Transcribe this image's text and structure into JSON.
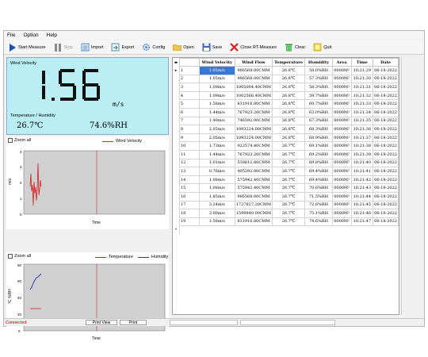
{
  "menu": [
    "File",
    "Option",
    "Help"
  ],
  "toolbar": [
    {
      "label": "Start Measure",
      "icon": "play-icon",
      "disabled": false
    },
    {
      "label": "Stop",
      "icon": "pause-icon",
      "disabled": true
    },
    {
      "label": "Import",
      "icon": "import-icon",
      "disabled": false
    },
    {
      "label": "Export",
      "icon": "export-icon",
      "disabled": false
    },
    {
      "label": "Config",
      "icon": "gear-icon",
      "disabled": false
    },
    {
      "label": "Open",
      "icon": "folder-icon",
      "disabled": false
    },
    {
      "label": "Save",
      "icon": "floppy-disk-icon",
      "disabled": false
    },
    {
      "label": "Close RT-Measure",
      "icon": "close-icon",
      "disabled": false
    },
    {
      "label": "Clear",
      "icon": "trash-icon",
      "disabled": false
    },
    {
      "label": "Quit",
      "icon": "quit-icon",
      "disabled": false
    }
  ],
  "readout": {
    "label": "Wind Velocity",
    "value": "1.56",
    "unit": "m/s",
    "th_label": "Temperature / Humidity",
    "temperature": "26.7℃",
    "humidity": "74.6%RH",
    "color": "#b9eef4"
  },
  "chart1": {
    "zoom_label": "Zoom all",
    "legend": "Wind Velocity",
    "ylabel": "m/s",
    "xlabel": "Time",
    "yticks": [
      "0",
      "1",
      "2",
      "3",
      "4"
    ]
  },
  "chart2": {
    "zoom_label": "Zoom all",
    "legend": [
      "Temperature",
      "Humidity"
    ],
    "ylabel": "℃ %RH",
    "xlabel": "Time",
    "yticks": [
      "0",
      "20",
      "40",
      "60",
      "80"
    ]
  },
  "colors": {
    "temperature": "#d42020",
    "humidity": "#2030b0",
    "wind": "#d42020"
  },
  "table": {
    "corner": "◂▸",
    "columns": [
      "",
      "Wind Velocity",
      "Wind Flow",
      "Temperature",
      "Humidity",
      "Area",
      "Time",
      "Date"
    ],
    "rows": [
      [
        "1",
        "1.05m/s",
        "986568.00CMM",
        "26.8℃",
        "58.0%RH",
        "0000M²",
        "10:21:29",
        "06-18-2022"
      ],
      [
        "2",
        "1.05m/s",
        "986568.00CMM",
        "26.8℃",
        "57.3%RH",
        "0000M²",
        "10:21:30",
        "06-18-2022"
      ],
      [
        "3",
        "1.09m/s",
        "1005004.40CMM",
        "26.8℃",
        "58.3%RH",
        "0000M²",
        "10:21:31",
        "06-18-2022"
      ],
      [
        "4",
        "1.09m/s",
        "1002566.40CMM",
        "26.8℃",
        "59.7%RH",
        "0000M²",
        "10:21:32",
        "06-18-2022"
      ],
      [
        "5",
        "1.56m/s",
        "831916.80CMM",
        "26.8℃",
        "60.7%RH",
        "0000M²",
        "10:21:33",
        "06-18-2022"
      ],
      [
        "6",
        "1.44m/s",
        "767923.20CMM",
        "26.8℃",
        "63.0%RH",
        "0000M²",
        "10:21:34",
        "06-18-2022"
      ],
      [
        "7",
        "1.40m/s",
        "746592.00CMM",
        "26.8℃",
        "67.3%RH",
        "0000M²",
        "10:21:35",
        "06-18-2022"
      ],
      [
        "8",
        "2.05m/s",
        "1093224.00CMM",
        "26.8℃",
        "68.3%RH",
        "0000M²",
        "10:21:36",
        "06-18-2022"
      ],
      [
        "9",
        "2.05m/s",
        "1093224.00CMM",
        "26.8℃",
        "68.9%RH",
        "0000M²",
        "10:21:37",
        "06-18-2022"
      ],
      [
        "10",
        "1.73m/s",
        "922574.40CMM",
        "26.7℃",
        "69.1%RH",
        "0000M²",
        "10:21:38",
        "06-18-2022"
      ],
      [
        "11",
        "1.44m/s",
        "767923.20CMM",
        "26.7℃",
        "69.2%RH",
        "0000M²",
        "10:21:39",
        "06-18-2022"
      ],
      [
        "12",
        "1.01m/s",
        "538612.80CMM",
        "26.7℃",
        "69.8%RH",
        "0000M²",
        "10:21:40",
        "06-18-2022"
      ],
      [
        "13",
        "0.76m/s",
        "405292.80CMM",
        "26.7℃",
        "69.4%RH",
        "0000M²",
        "10:21:41",
        "06-18-2022"
      ],
      [
        "14",
        "1.08m/s",
        "575942.40CMM",
        "26.7℃",
        "69.4%RH",
        "0000M²",
        "10:21:42",
        "06-18-2022"
      ],
      [
        "15",
        "1.08m/s",
        "575942.40CMM",
        "26.7℃",
        "70.6%RH",
        "0000M²",
        "10:21:43",
        "06-18-2022"
      ],
      [
        "16",
        "1.85m/s",
        "986568.00CMM",
        "26.7℃",
        "71.5%RH",
        "0000M²",
        "10:21:44",
        "06-18-2022"
      ],
      [
        "17",
        "3.24m/s",
        "1727827.20CMM",
        "26.7℃",
        "72.6%RH",
        "0000M²",
        "10:21:45",
        "06-18-2022"
      ],
      [
        "18",
        "3.00m/s",
        "1599840.00CMM",
        "26.7℃",
        "75.1%RH",
        "0000M²",
        "10:21:46",
        "06-18-2022"
      ],
      [
        "19",
        "1.56m/s",
        "831916.80CMM",
        "26.7℃",
        "74.6%RH",
        "0000M²",
        "10:21:47",
        "06-18-2022"
      ]
    ],
    "new_row_marker": "*",
    "current_marker": "▸"
  },
  "status": {
    "text": "Connected",
    "print_view": "Print View",
    "print": "Print"
  }
}
